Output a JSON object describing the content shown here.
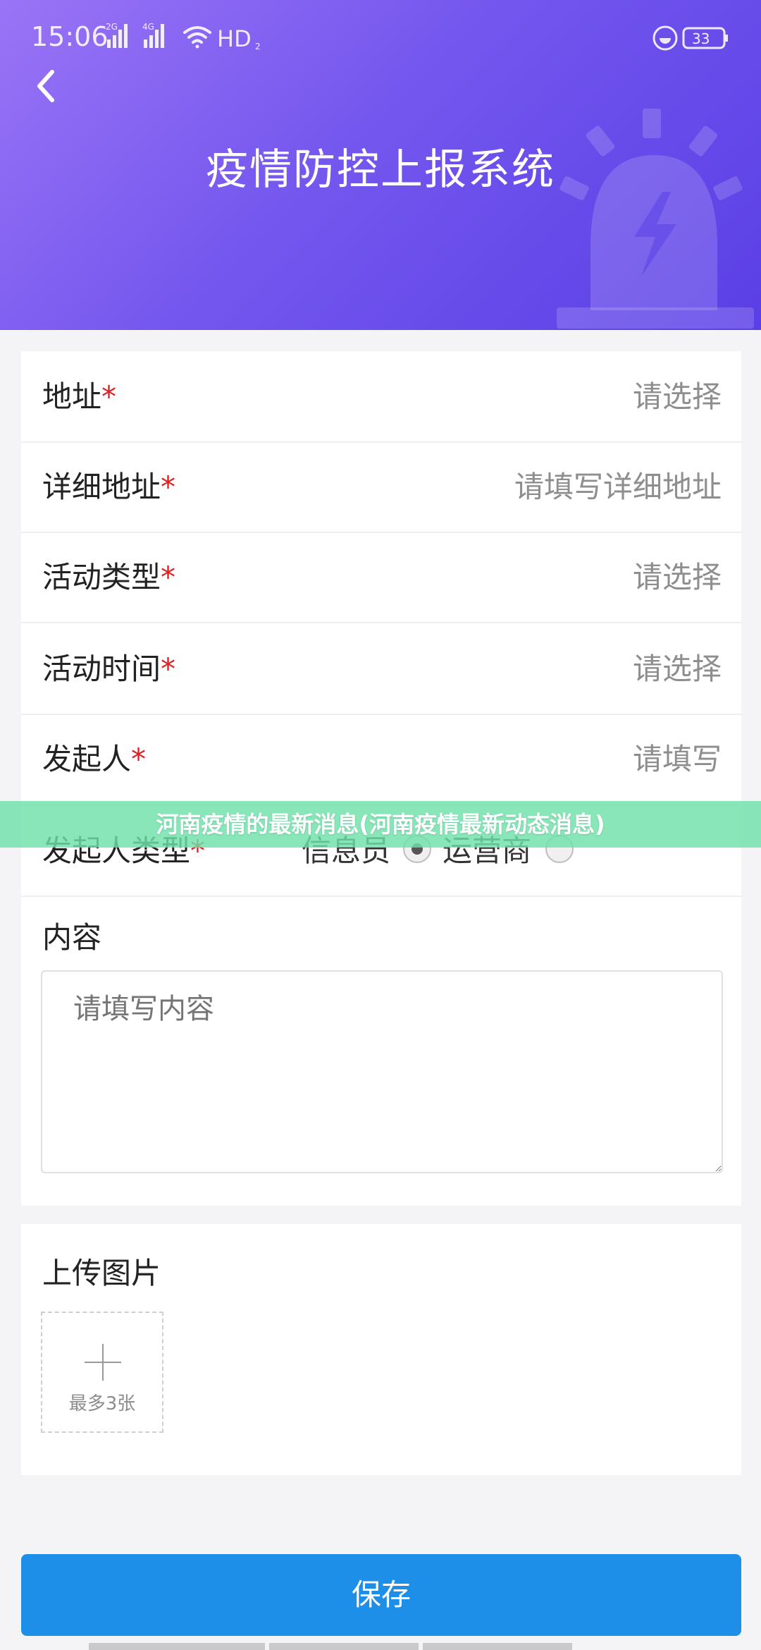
{
  "status_bar": {
    "time": "15:06",
    "network_left": "2G",
    "network_right": "4G",
    "hd": "HD",
    "battery": "33"
  },
  "header": {
    "title": "疫情防控上报系统",
    "gradient_colors": [
      "#9a74f6",
      "#5a3fe6"
    ]
  },
  "form": {
    "address_label": "地址",
    "address_placeholder": "请选择",
    "detail_address_label": "详细地址",
    "detail_address_placeholder": "请填写详细地址",
    "activity_type_label": "活动类型",
    "activity_type_placeholder": "请选择",
    "activity_time_label": "活动时间",
    "activity_time_placeholder": "请选择",
    "initiator_label": "发起人",
    "initiator_placeholder": "请填写",
    "initiator_type_label": "发起人类型",
    "initiator_type_options": [
      "信息员",
      "运营商"
    ],
    "initiator_type_selected": "信息员",
    "required_mark": "*",
    "content_label": "内容",
    "content_placeholder": "请填写内容"
  },
  "upload": {
    "title": "上传图片",
    "hint": "最多3张"
  },
  "save_label": "保存",
  "overlay_banner": "河南疫情的最新消息(河南疫情最新动态消息)",
  "colors": {
    "required": "#e02020",
    "primary_button": "#1e8fe8",
    "banner": "#6ee1aa"
  }
}
